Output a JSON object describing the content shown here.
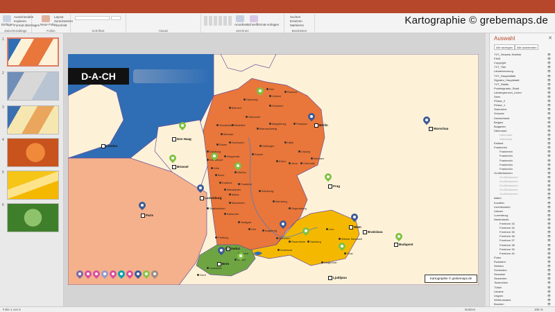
{
  "branding": "Kartographie © grebemaps.de",
  "ribbon": {
    "groups": [
      {
        "label": "Zwischenablage"
      },
      {
        "label": "Folien"
      },
      {
        "label": "Schriftart"
      },
      {
        "label": "Absatz"
      },
      {
        "label": "Zeichnen"
      },
      {
        "label": "Bearbeiten"
      }
    ],
    "items": {
      "einfuegen": "Einfügen",
      "ausschneiden": "Ausschneiden",
      "kopieren": "Kopieren",
      "format": "Format übertragen",
      "neue_folie": "Neue Folie",
      "layout": "Layout",
      "zuruecksetzen": "Zurücksetzen",
      "abschnitt": "Abschnitt",
      "anordnen": "Anordnen",
      "schnellformat": "Schnellformat-vorlagen",
      "suchen": "Suchen",
      "ersetzen": "Ersetzen",
      "markieren": "Markieren"
    }
  },
  "thumbnails": [
    {
      "num": "1"
    },
    {
      "num": "2"
    },
    {
      "num": "3"
    },
    {
      "num": "4"
    },
    {
      "num": "5"
    },
    {
      "num": "6"
    }
  ],
  "slide": {
    "title": "D-A-CH",
    "copyright": "Kartographie © grebemaps.de",
    "capitals": [
      {
        "name": "Den Haag"
      },
      {
        "name": "London"
      },
      {
        "name": "Brüssel"
      },
      {
        "name": "Luxemburg"
      },
      {
        "name": "Paris"
      },
      {
        "name": "Berlin"
      },
      {
        "name": "Warschau"
      },
      {
        "name": "Prag"
      },
      {
        "name": "Wien"
      },
      {
        "name": "Bratislava"
      },
      {
        "name": "Budapest"
      },
      {
        "name": "Bern"
      },
      {
        "name": "Vaduz"
      },
      {
        "name": "Ljubljana"
      }
    ],
    "cities": [
      {
        "name": "Kiel"
      },
      {
        "name": "Lübeck"
      },
      {
        "name": "Rostock"
      },
      {
        "name": "Hamburg"
      },
      {
        "name": "Bremen"
      },
      {
        "name": "Schwerin"
      },
      {
        "name": "Hannover"
      },
      {
        "name": "Magdeburg"
      },
      {
        "name": "Potsdam"
      },
      {
        "name": "Osnabrück"
      },
      {
        "name": "Bielefeld"
      },
      {
        "name": "Braunschweig"
      },
      {
        "name": "Münster"
      },
      {
        "name": "Essen"
      },
      {
        "name": "Dortmund"
      },
      {
        "name": "Duisburg"
      },
      {
        "name": "Düsseldorf"
      },
      {
        "name": "Wuppertal"
      },
      {
        "name": "Köln"
      },
      {
        "name": "Bonn"
      },
      {
        "name": "Göttingen"
      },
      {
        "name": "Kassel"
      },
      {
        "name": "Halle"
      },
      {
        "name": "Leipzig"
      },
      {
        "name": "Dresden"
      },
      {
        "name": "Erfurt"
      },
      {
        "name": "Jena"
      },
      {
        "name": "Chemnitz"
      },
      {
        "name": "Gießen"
      },
      {
        "name": "Koblenz"
      },
      {
        "name": "Frankfurt"
      },
      {
        "name": "Wiesbaden"
      },
      {
        "name": "Mainz"
      },
      {
        "name": "Würzburg"
      },
      {
        "name": "Mannheim"
      },
      {
        "name": "Saarbrücken"
      },
      {
        "name": "Nürnberg"
      },
      {
        "name": "Regensburg"
      },
      {
        "name": "Karlsruhe"
      },
      {
        "name": "Stuttgart"
      },
      {
        "name": "Ulm"
      },
      {
        "name": "Augsburg"
      },
      {
        "name": "München"
      },
      {
        "name": "Freiburg"
      },
      {
        "name": "Rosenheim"
      },
      {
        "name": "Linz"
      },
      {
        "name": "Salzburg"
      },
      {
        "name": "Innsbruck"
      },
      {
        "name": "Graz"
      },
      {
        "name": "Klagenfurt"
      },
      {
        "name": "Wiener Neustadt"
      },
      {
        "name": "Basel"
      },
      {
        "name": "Zürich"
      },
      {
        "name": "Luzern"
      },
      {
        "name": "Lausanne"
      },
      {
        "name": "Genf"
      }
    ],
    "legend_pin_colors": [
      "#7b68a6",
      "#d94f9c",
      "#d94f9c",
      "#9999cc",
      "#d94f9c",
      "#00a0b0",
      "#d94f9c",
      "#3a5a9c",
      "#8bc34a",
      "#9a8c84"
    ],
    "country_colors": {
      "germany": "#e9763a",
      "austria": "#f5b800",
      "switzerland": "#6ea542",
      "neighbors": "#fdf2d8",
      "france": "#f5b18c",
      "sea": "#2f6eb5"
    },
    "pin_colors": {
      "blue": "#3d5a96",
      "green": "#7ec242"
    }
  },
  "selection": {
    "header": "Auswahl",
    "show_all": "Alle anzeigen",
    "hide_all": "Alle ausblenden",
    "items": [
      {
        "label": "TXT_Hinweis-Textfeld"
      },
      {
        "label": "PINS"
      },
      {
        "label": "Copyright"
      },
      {
        "label": "TXT_Titel"
      },
      {
        "label": "Länderkennung"
      },
      {
        "label": "TXT_Hauptstädte"
      },
      {
        "label": "Signatur_Hauptstadt"
      },
      {
        "label": "TXT_Städte"
      },
      {
        "label": "Punktsignatur_Stadt"
      },
      {
        "label": "Ländergrenzen_Linien"
      },
      {
        "label": "Seen"
      },
      {
        "label": "Flüsse_2"
      },
      {
        "label": "Flüsse_1"
      },
      {
        "label": "Österreich"
      },
      {
        "label": "Schweiz"
      },
      {
        "label": "Deutschland"
      },
      {
        "label": "Belgien"
      },
      {
        "label": "Bulgarien"
      },
      {
        "label": "Dänemark"
      },
      {
        "label": "Dänemark",
        "grey": true,
        "indent": true
      },
      {
        "label": "Dänemark",
        "grey": true,
        "indent": true
      },
      {
        "label": "Estland"
      },
      {
        "label": "Frankreich"
      },
      {
        "label": "Frankreich",
        "indent": true
      },
      {
        "label": "Frankreich",
        "indent": true
      },
      {
        "label": "Frankreich",
        "indent": true
      },
      {
        "label": "Frankreich",
        "indent": true
      },
      {
        "label": "Frankreich",
        "indent": true
      },
      {
        "label": "Großbritannien"
      },
      {
        "label": "Großbritannien",
        "grey": true,
        "indent": true
      },
      {
        "label": "Großbritannien",
        "grey": true,
        "indent": true
      },
      {
        "label": "Großbritannien",
        "grey": true,
        "indent": true
      },
      {
        "label": "Großbritannien",
        "grey": true,
        "indent": true
      },
      {
        "label": "Großbritannien",
        "grey": true,
        "indent": true
      },
      {
        "label": "Italien"
      },
      {
        "label": "Kroatien"
      },
      {
        "label": "Liechtenstein"
      },
      {
        "label": "Litauen"
      },
      {
        "label": "Luxemburg"
      },
      {
        "label": "Niederlande"
      },
      {
        "label": "Freeform 33",
        "indent": true
      },
      {
        "label": "Freeform 34",
        "indent": true
      },
      {
        "label": "Freeform 35",
        "indent": true
      },
      {
        "label": "Freeform 36",
        "indent": true
      },
      {
        "label": "Freeform 37",
        "indent": true
      },
      {
        "label": "Freeform 38",
        "indent": true
      },
      {
        "label": "Freeform 39",
        "indent": true
      },
      {
        "label": "Freeform 40",
        "indent": true
      },
      {
        "label": "Polen"
      },
      {
        "label": "Russland"
      },
      {
        "label": "Serbien"
      },
      {
        "label": "Schweden"
      },
      {
        "label": "Slowakei"
      },
      {
        "label": "Slowenien"
      },
      {
        "label": "Tschechien"
      },
      {
        "label": "Türkei"
      },
      {
        "label": "Ukraine"
      },
      {
        "label": "Ungarn"
      },
      {
        "label": "Weißrussland"
      },
      {
        "label": "Bosnien"
      }
    ]
  },
  "status": {
    "slide": "Folie 1 von 6",
    "notes": "Notizen",
    "zoom": "106 %"
  }
}
